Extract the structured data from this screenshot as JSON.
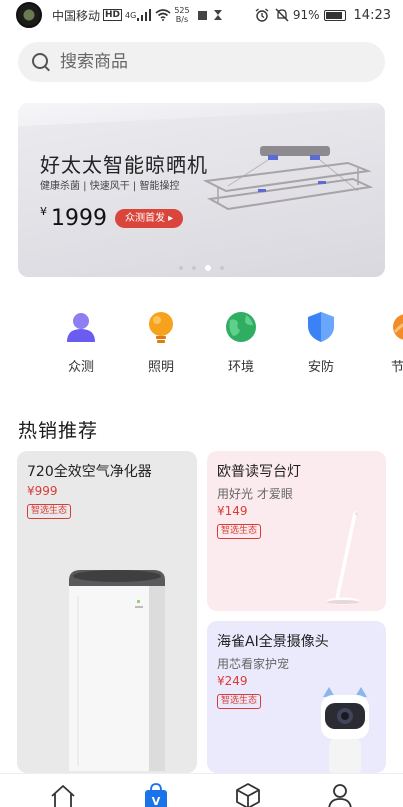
{
  "status_bar": {
    "carrier": "中国移动",
    "hd_label": "HD",
    "signal_label": "4G",
    "net_speed_value": "525",
    "net_speed_unit": "B/s",
    "battery_percent": "91%",
    "time": "14:23"
  },
  "search": {
    "placeholder": "搜索商品"
  },
  "banner": {
    "title": "好太太智能晾晒机",
    "subtitle": "健康杀菌 | 快速风干 | 智能操控",
    "price_symbol": "¥",
    "price": "1999",
    "button_label": "众测首发 ▸",
    "active_slide": 3,
    "slide_count": 4
  },
  "categories": [
    {
      "label": "众测",
      "icon": "person-icon",
      "color": "#7b6cf0"
    },
    {
      "label": "照明",
      "icon": "bulb-icon",
      "color": "#f5a623"
    },
    {
      "label": "环境",
      "icon": "globe-icon",
      "color": "#3bb56a"
    },
    {
      "label": "安防",
      "icon": "shield-icon",
      "color": "#3b82f6"
    },
    {
      "label": "节",
      "icon": "energy-icon",
      "color": "#f28c28"
    }
  ],
  "hot_section": {
    "title": "热销推荐",
    "products": [
      {
        "name": "720全效空气净化器",
        "desc": "",
        "price": "¥999",
        "tag": "智选生态"
      },
      {
        "name": "欧普读写台灯",
        "desc": "用好光 才爱眼",
        "price": "¥149",
        "tag": "智选生态"
      },
      {
        "name": "海雀AI全景摄像头",
        "desc": "用芯看家护宠",
        "price": "¥249",
        "tag": "智选生态"
      }
    ]
  },
  "bottom_nav": {
    "items": [
      {
        "icon": "home-icon",
        "active": false
      },
      {
        "icon": "vmall-bag-icon",
        "active": true,
        "badge_letter": "V"
      },
      {
        "icon": "cube-icon",
        "active": false
      },
      {
        "icon": "profile-icon",
        "active": false
      }
    ]
  },
  "colors": {
    "accent_red": "#d93b36",
    "active_nav": "#1a73e8"
  }
}
